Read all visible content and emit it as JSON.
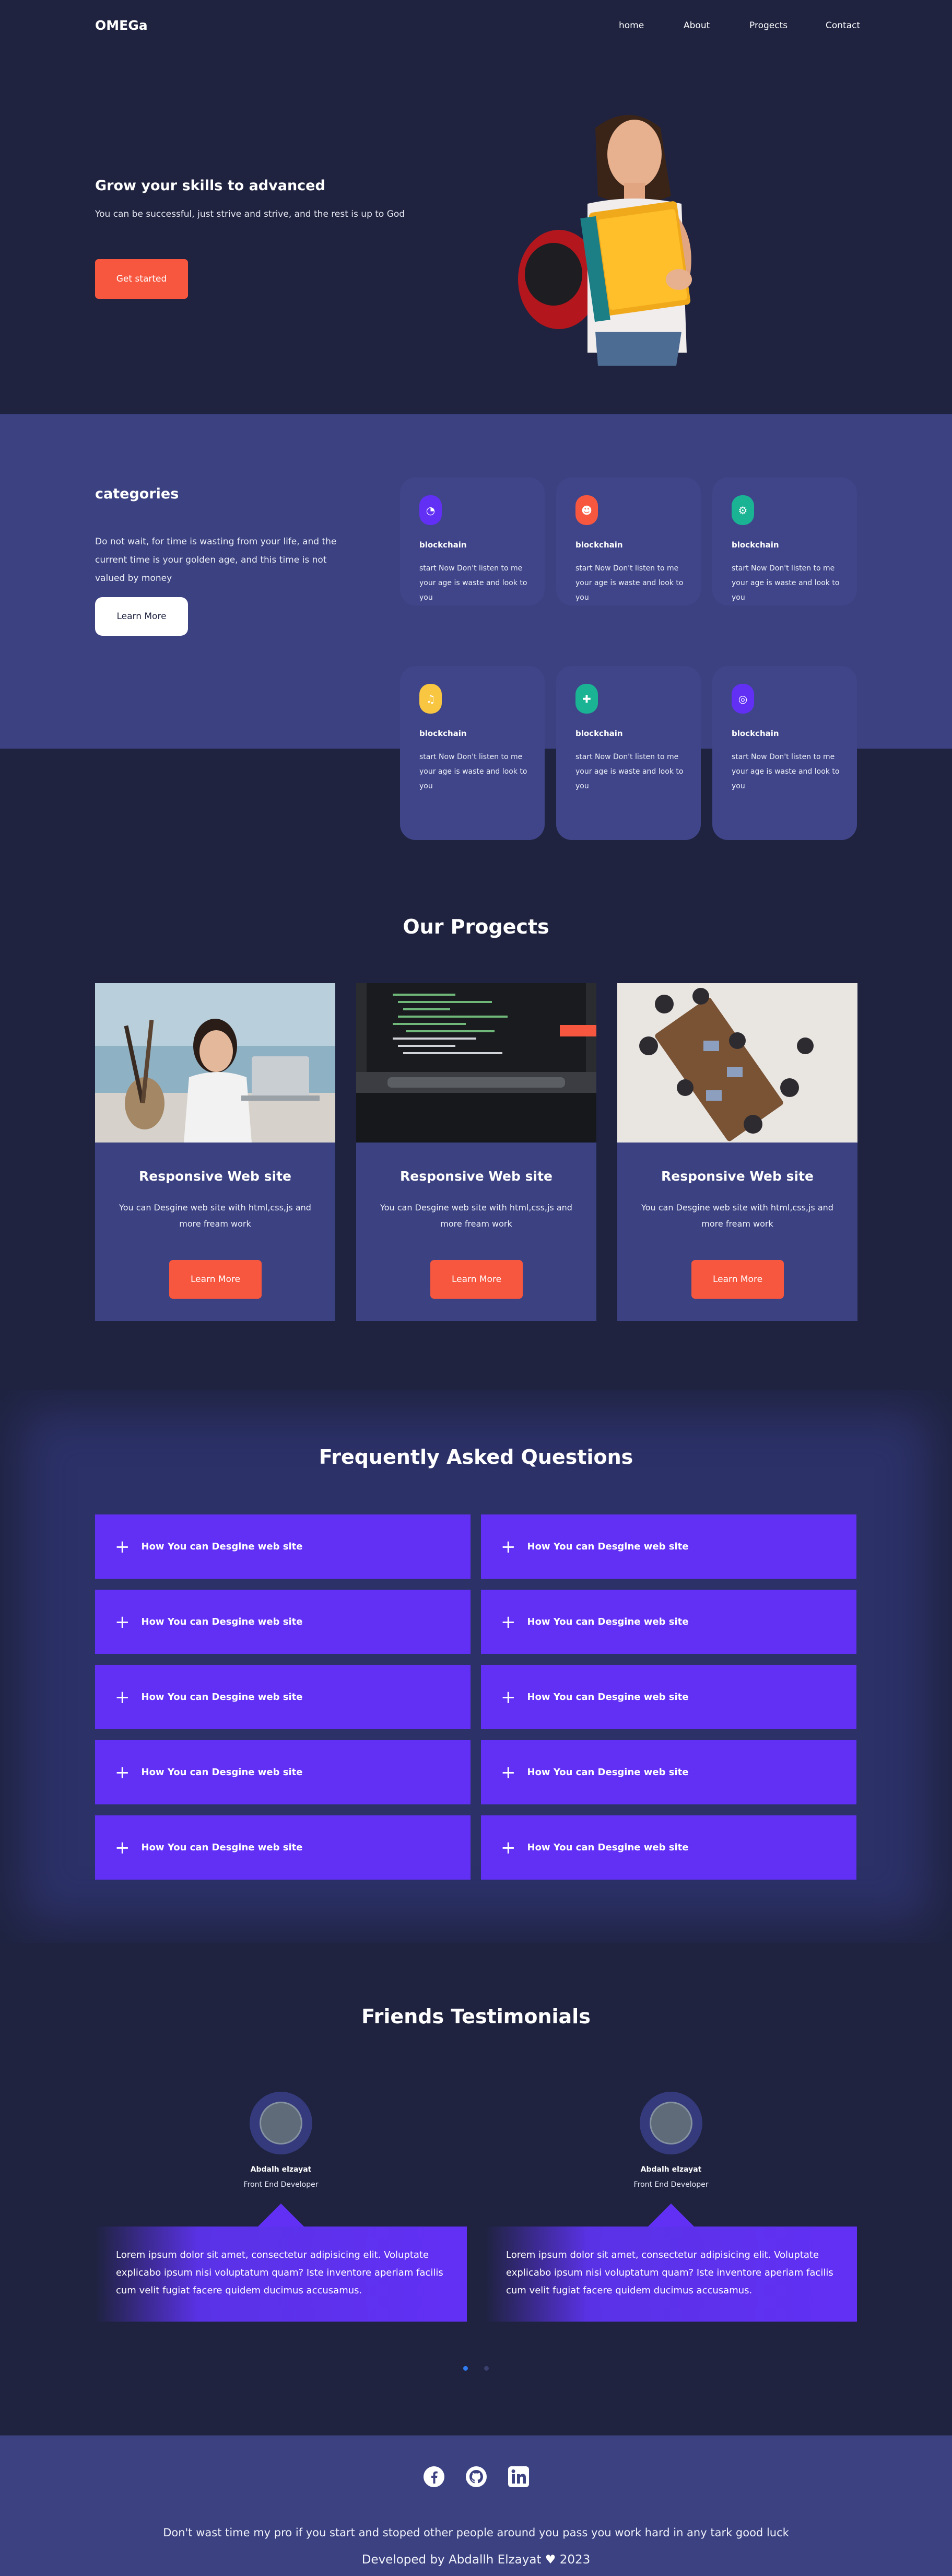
{
  "nav": {
    "logo": "OMEGa",
    "links": [
      "home",
      "About",
      "Progects",
      "Contact"
    ]
  },
  "hero": {
    "title": "Grow your skills to advanced",
    "subtitle": "You can be successful, just strive and strive, and the rest is up to God",
    "cta": "Get started"
  },
  "categories": {
    "title": "categories",
    "text": "Do not wait, for time is wasting from your life, and the current time is your golden age, and this time is not valued by money",
    "button": "Learn More",
    "cards": [
      {
        "title": "blockchain",
        "desc": "start Now Don't listen to me your age is waste and look to you",
        "icon": "pie-chart-icon",
        "color": "#6230f5"
      },
      {
        "title": "blockchain",
        "desc": "start Now Don't listen to me your age is waste and look to you",
        "icon": "user-circle-icon",
        "color": "#f7573f"
      },
      {
        "title": "blockchain",
        "desc": "start Now Don't listen to me your age is waste and look to you",
        "icon": "gear-icon",
        "color": "#1ab394"
      },
      {
        "title": "blockchain",
        "desc": "start Now Don't listen to me your age is waste and look to you",
        "icon": "music-icon",
        "color": "#f9c642"
      },
      {
        "title": "blockchain",
        "desc": "start Now Don't listen to me your age is waste and look to you",
        "icon": "puzzle-icon",
        "color": "#1ab394"
      },
      {
        "title": "blockchain",
        "desc": "start Now Don't listen to me your age is waste and look to you",
        "icon": "target-icon",
        "color": "#6230f5"
      }
    ]
  },
  "projects": {
    "heading": "Our Progects",
    "items": [
      {
        "title": "Responsive Web site",
        "desc": "You can Desgine web site with html,css,js and more fream work",
        "button": "Learn More"
      },
      {
        "title": "Responsive Web site",
        "desc": "You can Desgine web site with html,css,js and more fream work",
        "button": "Learn More"
      },
      {
        "title": "Responsive Web site",
        "desc": "You can Desgine web site with html,css,js and more fream work",
        "button": "Learn More"
      }
    ]
  },
  "faq": {
    "heading": "Frequently Asked Questions",
    "items": [
      "How You can Desgine web site",
      "How You can Desgine web site",
      "How You can Desgine web site",
      "How You can Desgine web site",
      "How You can Desgine web site",
      "How You can Desgine web site",
      "How You can Desgine web site",
      "How You can Desgine web site",
      "How You can Desgine web site",
      "How You can Desgine web site"
    ]
  },
  "testimonials": {
    "heading": "Friends Testimonials",
    "items": [
      {
        "name": "Abdalh elzayat",
        "role": "Front End Developer",
        "text": "Lorem ipsum dolor sit amet, consectetur adipisicing elit. Voluptate explicabo ipsum nisi voluptatum quam? Iste inventore aperiam facilis cum velit fugiat facere quidem ducimus accusamus."
      },
      {
        "name": "Abdalh elzayat",
        "role": "Front End Developer",
        "text": "Lorem ipsum dolor sit amet, consectetur adipisicing elit. Voluptate explicabo ipsum nisi voluptatum quam? Iste inventore aperiam facilis cum velit fugiat facere quidem ducimus accusamus."
      }
    ]
  },
  "footer": {
    "socials": [
      "facebook-icon",
      "github-icon",
      "linkedin-icon"
    ],
    "text": "Don't wast time my pro if you start and stoped other people around you pass you work hard in any tark good luck",
    "developed_prefix": "Developed by Abdallh Elzayat",
    "year": "2023"
  },
  "colors": {
    "background": "#1f2340",
    "band": "#3b4181",
    "accent_orange": "#f7573f",
    "accent_purple": "#6230f5"
  }
}
